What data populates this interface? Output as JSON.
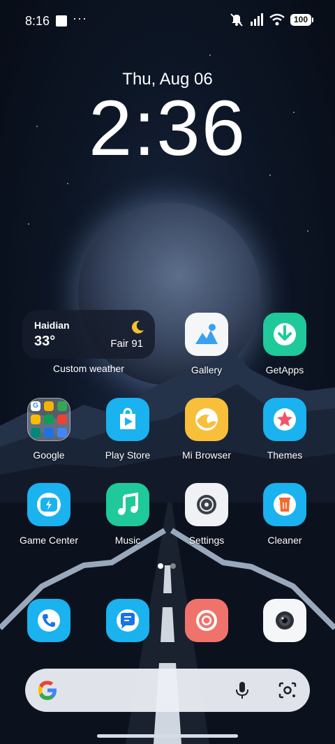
{
  "status_bar": {
    "time": "8:16",
    "dots": "···",
    "battery": "100"
  },
  "clock": {
    "date": "Thu, Aug 06",
    "time": "2:36"
  },
  "weather_widget": {
    "city": "Haidian",
    "temperature": "33°",
    "condition": "Fair 91",
    "label": "Custom weather"
  },
  "apps": {
    "gallery": "Gallery",
    "getapps": "GetApps",
    "google": "Google",
    "play_store": "Play Store",
    "mi_browser": "Mi Browser",
    "themes": "Themes",
    "game_center": "Game Center",
    "music": "Music",
    "settings": "Settings",
    "cleaner": "Cleaner"
  },
  "dock": [
    "phone-icon",
    "messages-icon",
    "chrome-icon",
    "camera-icon"
  ],
  "colors": {
    "getapps": "#1fc99a",
    "play_store": "#1ab2ef",
    "mi_browser": "#f8bf3a",
    "themes": "#1ab2ef",
    "game_center": "#1ab2ef",
    "music": "#1fc99a",
    "cleaner": "#1ab2ef",
    "chrome": "#f0736b"
  }
}
